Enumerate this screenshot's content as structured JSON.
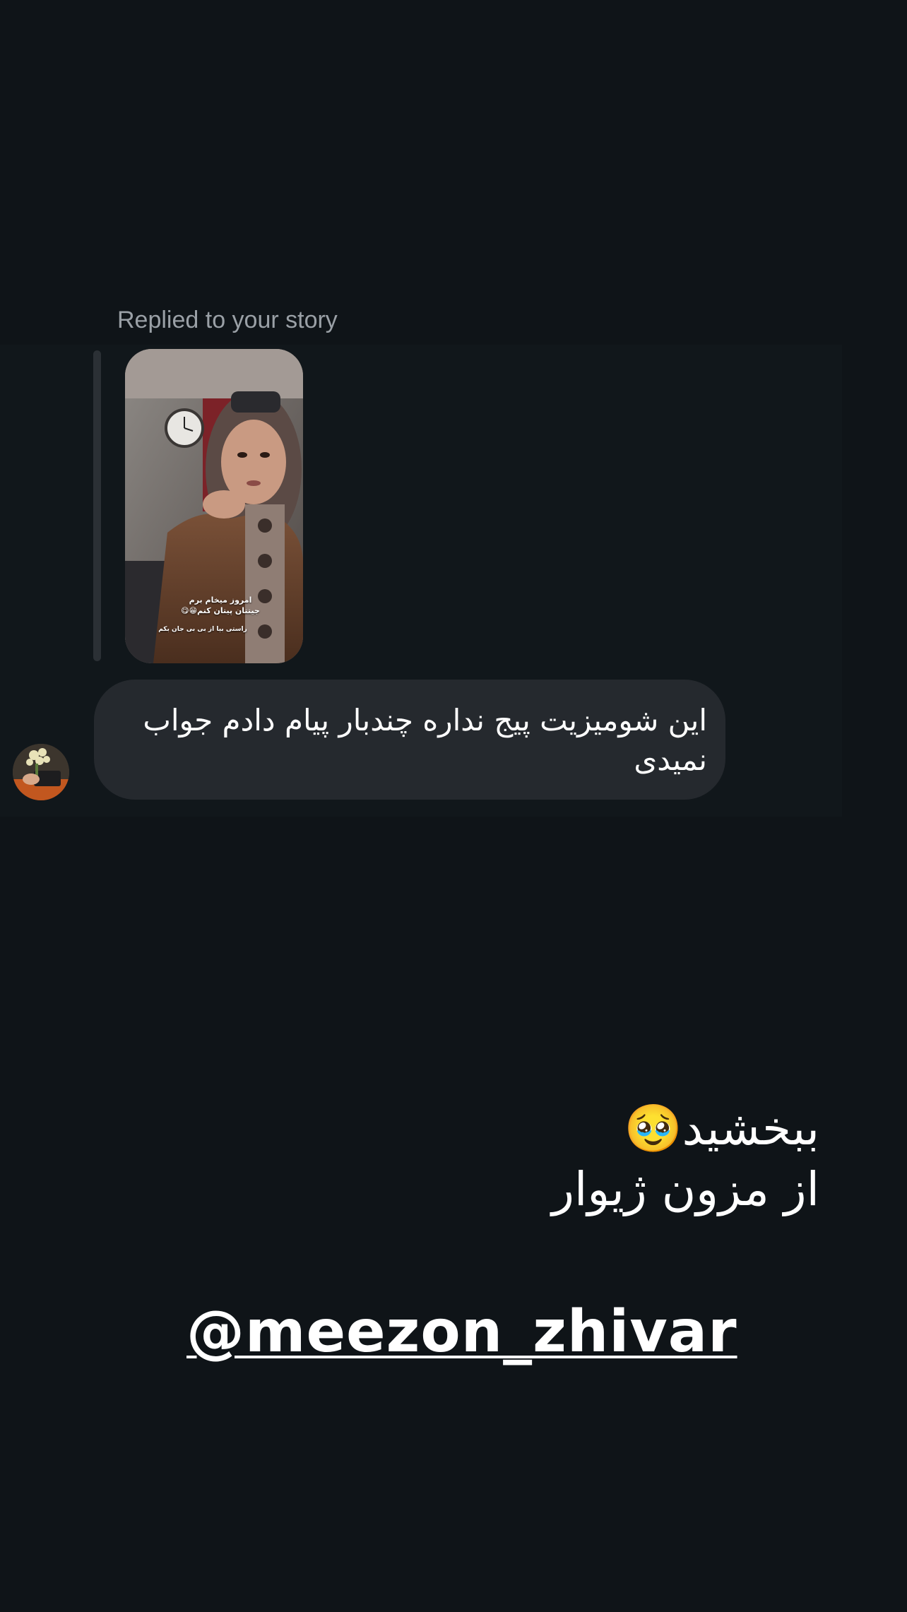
{
  "thread": {
    "replied_label": "Replied to your story",
    "story": {
      "caption_line1": "امروز میخام برم",
      "caption_line2": "جیتتان پیتان کنم😁😋",
      "caption_line3": "راستی بیا از بی بی جان بکم"
    },
    "message": {
      "text": "این شومیزیت پیج نداره چندبار پیام دادم جواب نمیدی"
    }
  },
  "overlay": {
    "apology_line1": "ببخشید🥹",
    "apology_line2": "از مزون ژیوار",
    "handle": "@meezon_zhivar"
  },
  "colors": {
    "background": "#0f1418",
    "bubble": "#25292e",
    "label": "#9aa0a6",
    "quote_bar": "#2b3035",
    "text": "#ffffff"
  }
}
